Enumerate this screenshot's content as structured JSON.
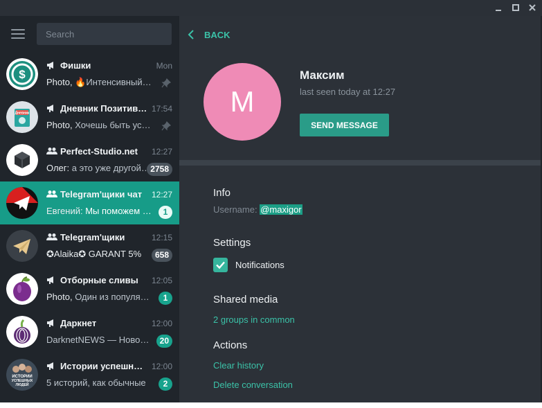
{
  "window": {
    "controls": [
      "minimize-icon",
      "maximize-icon",
      "close-icon"
    ]
  },
  "sidebar": {
    "search_placeholder": "Search",
    "chats": [
      {
        "title": "Фишки",
        "type": "channel",
        "time": "Mon",
        "sender": "",
        "preview_lead": "Photo, ",
        "preview": "🔥Интенсивный курс",
        "pinned": true,
        "badge": ""
      },
      {
        "title": "Дневник Позитивного",
        "type": "channel",
        "time": "17:54",
        "sender": "",
        "preview_lead": "Photo, ",
        "preview": "Хочешь быть успешным",
        "pinned": true,
        "badge": ""
      },
      {
        "title": "Perfect-Studio.net",
        "type": "group",
        "time": "12:27",
        "sender": "Олег: ",
        "preview_lead": "",
        "preview": "а это уже другой вопрос",
        "pinned": false,
        "badge": "2758",
        "badge_muted": true
      },
      {
        "title": "Telegram'щики чат",
        "type": "group",
        "time": "12:27",
        "sender": "Евгений: ",
        "preview_lead": "",
        "preview": "Мы поможем вам",
        "pinned": false,
        "badge": "1",
        "active": true
      },
      {
        "title": "Telegram'щики",
        "type": "group",
        "time": "12:15",
        "sender": "",
        "preview_lead": "",
        "preview": "✪Alaika✪ GARANT 5%",
        "pinned": false,
        "badge": "658",
        "badge_muted": true
      },
      {
        "title": "Отборные сливы",
        "type": "channel",
        "time": "12:05",
        "sender": "",
        "preview_lead": "Photo, ",
        "preview": "Один из популярных",
        "pinned": false,
        "badge": "1"
      },
      {
        "title": "Даркнет",
        "type": "channel",
        "time": "12:00",
        "sender": "",
        "preview_lead": "",
        "preview": "DarknetNEWS — Новости",
        "pinned": false,
        "badge": "20"
      },
      {
        "title": "Истории успешных людей",
        "type": "channel",
        "time": "12:00",
        "sender": "",
        "preview_lead": "",
        "preview": "5 историй, как обычные",
        "pinned": false,
        "badge": "2"
      }
    ],
    "avatar_labels": {
      "diary": "Дневник",
      "stories_line1": "ИСТОРИИ",
      "stories_line2": "УСПЕШНЫХ",
      "stories_line3": "ЛЮДЕЙ"
    }
  },
  "profile": {
    "back_label": "BACK",
    "avatar_letter": "M",
    "name": "Максим",
    "status": "last seen today at 12:27",
    "send_message_label": "SEND MESSAGE",
    "info_heading": "Info",
    "username_label": "Username: ",
    "username": "@maxigor",
    "settings_heading": "Settings",
    "notifications_label": "Notifications",
    "notifications_enabled": true,
    "shared_media_heading": "Shared media",
    "groups_in_common": "2 groups in common",
    "actions_heading": "Actions",
    "clear_history": "Clear history",
    "delete_conversation": "Delete conversation"
  },
  "colors": {
    "accent": "#179c88",
    "link": "#3bc2a8",
    "avatar_pink": "#ef8bb6",
    "sidebar_bg": "#20252b",
    "panel_bg": "#2c3138"
  }
}
